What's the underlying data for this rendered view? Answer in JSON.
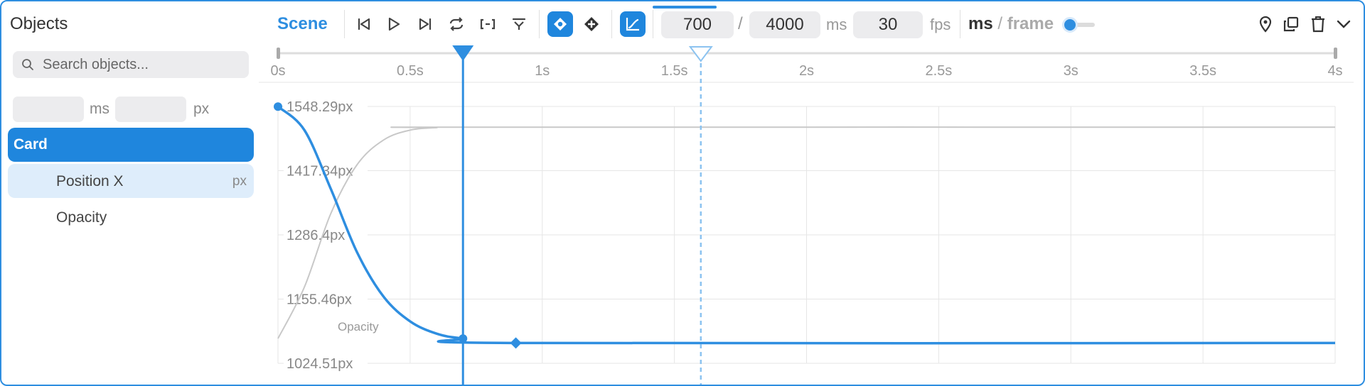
{
  "sidebar": {
    "title": "Objects",
    "search_placeholder": "Search objects...",
    "input_unit_time": "ms",
    "input_unit_value": "px",
    "object": "Card",
    "properties": [
      {
        "label": "Position X",
        "unit": "px"
      },
      {
        "label": "Opacity",
        "unit": ""
      }
    ]
  },
  "toolbar": {
    "scene_label": "Scene",
    "current_time": "700",
    "separator": "/",
    "duration": "4000",
    "duration_unit": "ms",
    "fps": "30",
    "fps_unit": "fps",
    "mode_ms": "ms",
    "mode_slash": "/",
    "mode_frame": "frame",
    "icons": [
      "skip-start-icon",
      "play-icon",
      "skip-end-icon",
      "loop-icon",
      "fit-range-icon",
      "filter-icon",
      "keyframe-icon",
      "add-keyframe-icon",
      "graph-icon",
      "pin-icon",
      "duplicate-icon",
      "trash-icon",
      "chevron-down-icon"
    ]
  },
  "timeline": {
    "ticks": [
      "0s",
      "0.5s",
      "1s",
      "1.5s",
      "2s",
      "2.5s",
      "3s",
      "3.5s",
      "4s"
    ],
    "playhead_ms": 700,
    "hover_ms": 1600,
    "max_ms": 4000
  },
  "chart_data": {
    "type": "line",
    "y_labels": [
      "1548.29px",
      "1417.34px",
      "1286.4px",
      "1155.46px",
      "1024.51px"
    ],
    "ylim": [
      1024.51,
      1548.29
    ],
    "xlim": [
      0,
      4000
    ],
    "series": [
      {
        "name": "Position X",
        "color": "#2e8ee0",
        "points": [
          [
            0,
            1548
          ],
          [
            100,
            1500
          ],
          [
            200,
            1380
          ],
          [
            300,
            1250
          ],
          [
            400,
            1160
          ],
          [
            500,
            1110
          ],
          [
            600,
            1085
          ],
          [
            700,
            1075
          ],
          [
            900,
            1066
          ],
          [
            4000,
            1066
          ]
        ]
      },
      {
        "name": "Opacity",
        "color": "#c8c8c8",
        "points": [
          [
            0,
            1075
          ],
          [
            100,
            1180
          ],
          [
            200,
            1330
          ],
          [
            300,
            1430
          ],
          [
            400,
            1480
          ],
          [
            500,
            1500
          ],
          [
            600,
            1505
          ],
          [
            700,
            1506
          ],
          [
            4000,
            1506
          ]
        ]
      }
    ],
    "keyframes_ms": [
      700,
      900
    ],
    "series_label": "Opacity"
  },
  "colors": {
    "accent": "#2e8ee0",
    "accent_dark": "#1f86dd",
    "grid": "#e6e6e6",
    "curve_inactive": "#c8c8c8"
  }
}
